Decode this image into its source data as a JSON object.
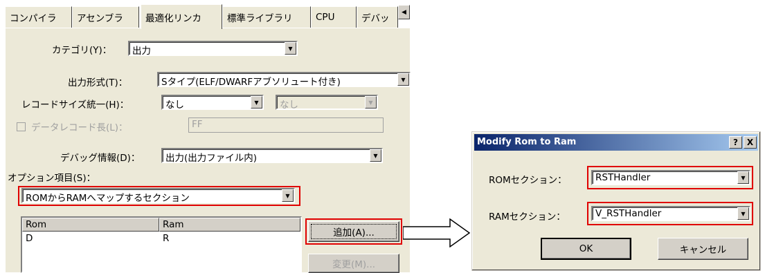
{
  "tabs": [
    "コンパイラ",
    "アセンブラ",
    "最適化リンカ",
    "標準ライブラリ",
    "CPU",
    "デバッ"
  ],
  "tab_scroll_glyph": "◀",
  "category": {
    "label": "カテゴリ(Y)：",
    "value": "出力"
  },
  "output_format": {
    "label": "出力形式(T)：",
    "value": "Sタイプ(ELF/DWARFアブソリュート付き)"
  },
  "record_size": {
    "label": "レコードサイズ統一(H)：",
    "value": "なし",
    "value2": "なし"
  },
  "data_record_length": {
    "label": "データレコード長(L)：",
    "value": "FF"
  },
  "debug_info": {
    "label": "デバッグ情報(D)：",
    "value": "出力(出力ファイル内)"
  },
  "options": {
    "label": "オプション項目(S)：",
    "value": "ROMからRAMへマップするセクション"
  },
  "section_list": {
    "columns": [
      "Rom",
      "Ram"
    ],
    "rows": [
      [
        "D",
        "R"
      ]
    ]
  },
  "buttons": {
    "add": "追加(A)...",
    "change": "変更(M)..."
  },
  "dialog": {
    "title": "Modify Rom to Ram",
    "help_glyph": "?",
    "close_glyph": "X",
    "rom_label": "ROMセクション：",
    "rom_value": "RSTHandler",
    "ram_label": "RAMセクション：",
    "ram_value": "V_RSTHandler",
    "ok": "OK",
    "cancel": "キャンセル"
  },
  "colors": {
    "highlight": "#e00000",
    "titlebar": "#0a246a",
    "panel": "#ece9d8"
  }
}
